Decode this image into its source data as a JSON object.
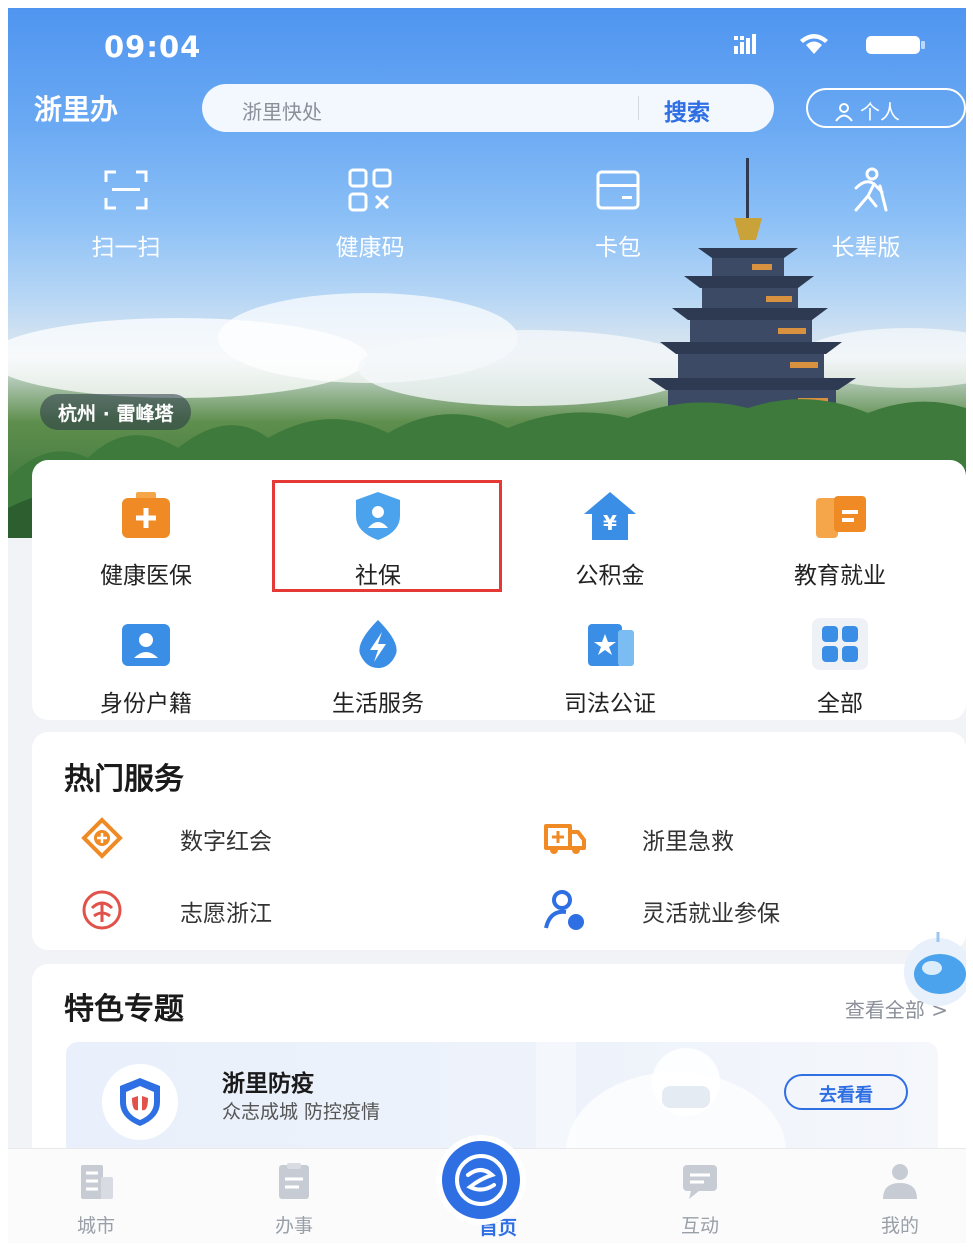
{
  "status_bar": {
    "time": "09:04"
  },
  "header": {
    "app_title": "浙里办",
    "search": {
      "placeholder": "浙里快处",
      "button_label": "搜索"
    },
    "personal_label": "个人"
  },
  "quick_actions": [
    {
      "label": "扫一扫",
      "icon": "scan-icon"
    },
    {
      "label": "健康码",
      "icon": "qr-code-icon"
    },
    {
      "label": "卡包",
      "icon": "card-wallet-icon"
    },
    {
      "label": "长辈版",
      "icon": "elder-mode-icon"
    }
  ],
  "hero": {
    "location": "杭州 · 雷峰塔"
  },
  "services": [
    {
      "label": "健康医保",
      "icon": "medical-kit-icon"
    },
    {
      "label": "社保",
      "icon": "social-security-shield-icon",
      "highlighted": true
    },
    {
      "label": "公积金",
      "icon": "housing-fund-icon"
    },
    {
      "label": "教育就业",
      "icon": "education-icon"
    },
    {
      "label": "身份户籍",
      "icon": "id-card-icon"
    },
    {
      "label": "生活服务",
      "icon": "lightning-drop-icon"
    },
    {
      "label": "司法公证",
      "icon": "notary-icon"
    },
    {
      "label": "全部",
      "icon": "grid-all-icon"
    }
  ],
  "hot_services": {
    "title": "热门服务",
    "items": [
      {
        "label": "数字红会",
        "icon": "red-cross-icon"
      },
      {
        "label": "浙里急救",
        "icon": "ambulance-icon"
      },
      {
        "label": "志愿浙江",
        "icon": "volunteer-icon"
      },
      {
        "label": "灵活就业参保",
        "icon": "flexible-employment-icon"
      }
    ]
  },
  "featured": {
    "title": "特色专题",
    "view_all": "查看全部 >",
    "card": {
      "title": "浙里防疫",
      "subtitle": "众志成城 防控疫情",
      "button": "去看看"
    }
  },
  "tabbar": [
    {
      "label": "城市",
      "icon": "city-icon"
    },
    {
      "label": "办事",
      "icon": "tasks-icon"
    },
    {
      "label": "首页",
      "icon": "home-logo-icon",
      "active": true
    },
    {
      "label": "互动",
      "icon": "chat-icon"
    },
    {
      "label": "我的",
      "icon": "profile-icon"
    }
  ],
  "colors": {
    "accent": "#2f6fe4",
    "highlight_border": "#e53935",
    "orange": "#f08a24"
  }
}
